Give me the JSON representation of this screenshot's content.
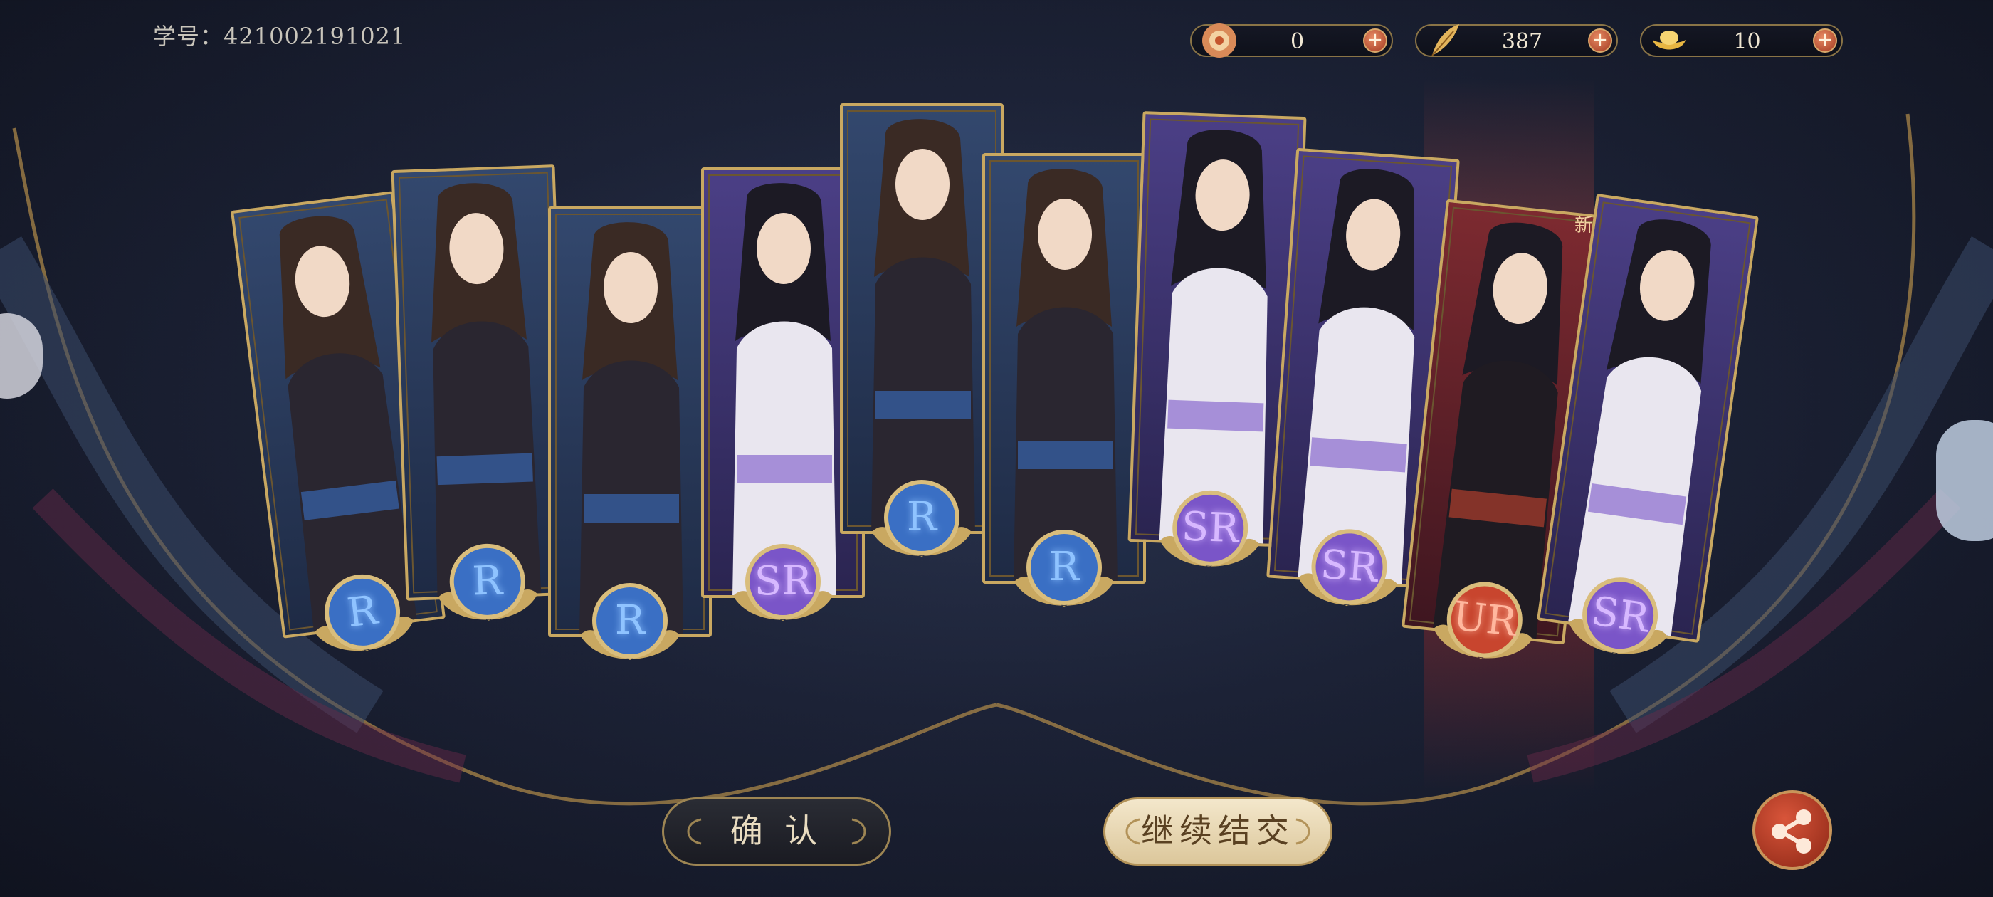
{
  "header": {
    "student_id": "学号：421002191021"
  },
  "currencies": [
    {
      "icon": "flower-token-icon",
      "value": "0"
    },
    {
      "icon": "feather-icon",
      "value": "387"
    },
    {
      "icon": "gold-ingot-icon",
      "value": "10"
    }
  ],
  "cards": [
    {
      "rarity": "R",
      "theme": "blue"
    },
    {
      "rarity": "R",
      "theme": "blue"
    },
    {
      "rarity": "R",
      "theme": "blue"
    },
    {
      "rarity": "SR",
      "theme": "purple"
    },
    {
      "rarity": "R",
      "theme": "blue"
    },
    {
      "rarity": "R",
      "theme": "blue"
    },
    {
      "rarity": "SR",
      "theme": "purple"
    },
    {
      "rarity": "SR",
      "theme": "purple"
    },
    {
      "rarity": "UR",
      "theme": "red",
      "new_label": "新"
    },
    {
      "rarity": "SR",
      "theme": "purple"
    }
  ],
  "buttons": {
    "confirm": "确 认",
    "continue": "继续结交"
  },
  "colors": {
    "r_badge": "#3a6fc4",
    "sr_badge": "#7a55c8",
    "ur_badge": "#c8452e",
    "gold_frame": "#c9a861"
  }
}
